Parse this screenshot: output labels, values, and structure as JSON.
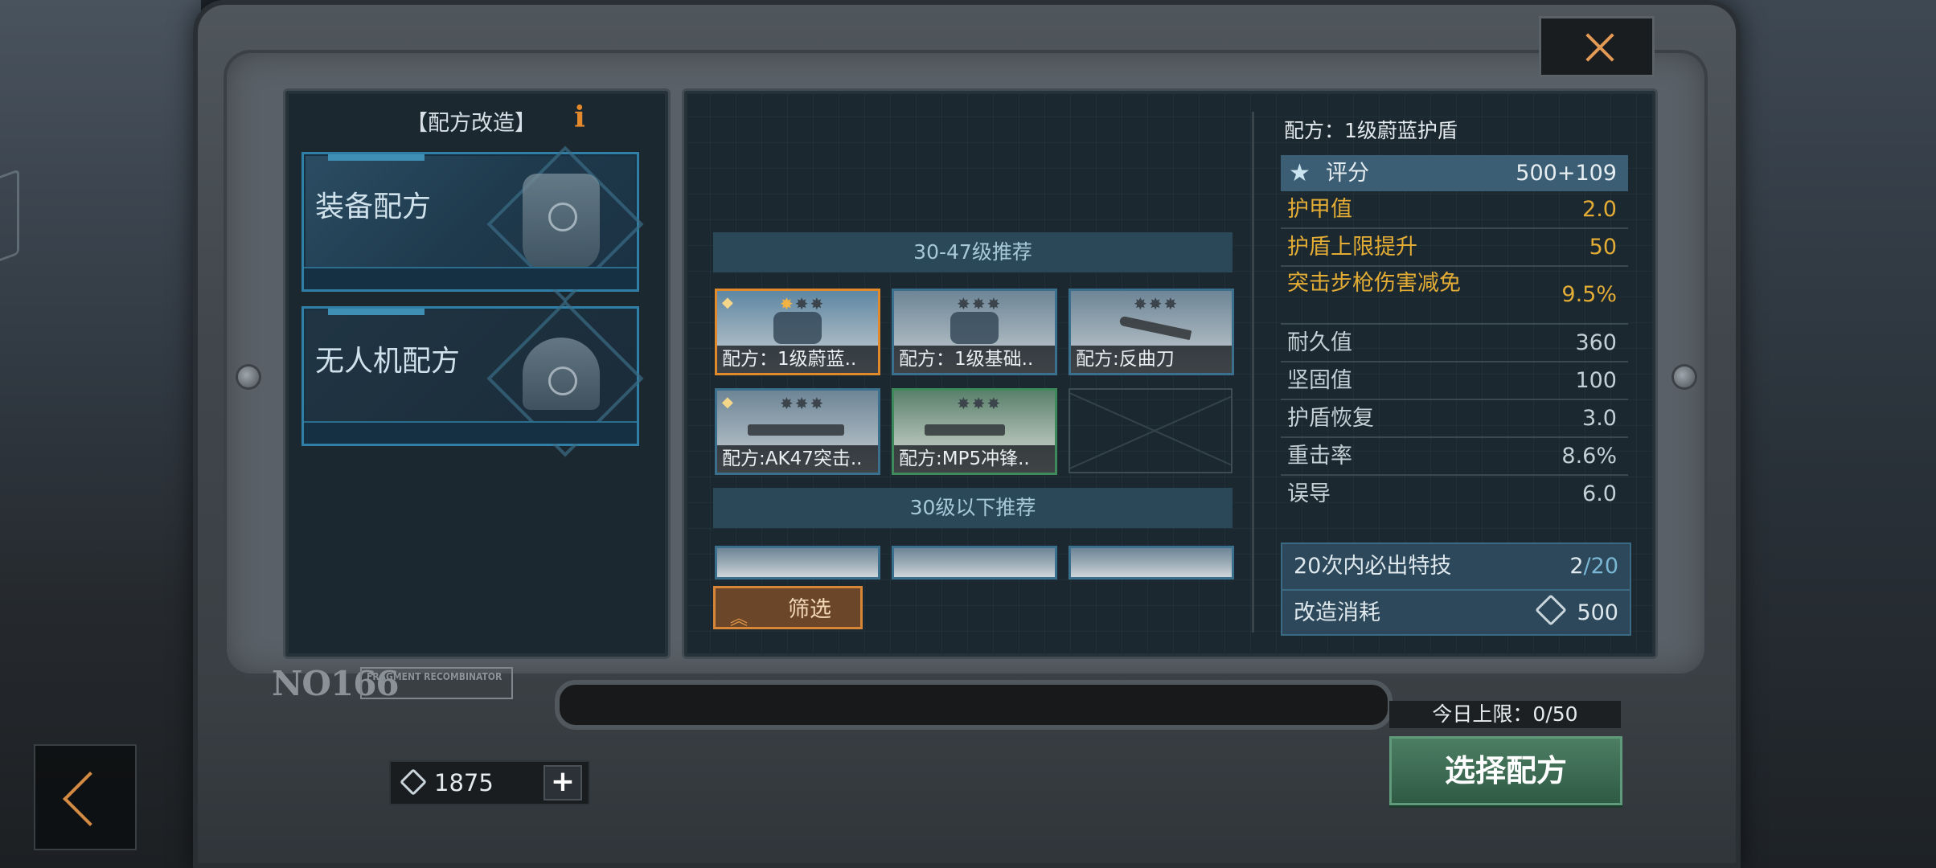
{
  "left": {
    "title": "【配方改造】",
    "info_glyph": "i",
    "cards": [
      {
        "label": "装备配方"
      },
      {
        "label": "无人机配方"
      }
    ]
  },
  "center": {
    "section1": "30-47级推荐",
    "section2": "30级以下推荐",
    "items": [
      {
        "caption": "配方：1级蔚蓝..",
        "border": "orange",
        "stars": 1
      },
      {
        "caption": "配方：1级基础..",
        "border": "blue",
        "stars": 0
      },
      {
        "caption": "配方:反曲刀",
        "border": "blue",
        "stars": 0
      },
      {
        "caption": "配方:AK47突击..",
        "border": "blue",
        "stars": 0
      },
      {
        "caption": "配方:MP5冲锋..",
        "border": "green",
        "stars": 0
      }
    ],
    "filter_label": "筛选"
  },
  "stats": {
    "title": "配方：1级蔚蓝护盾",
    "score": {
      "name": "评分",
      "value": "500+109"
    },
    "rows": [
      {
        "name": "护甲值",
        "value": "2.0",
        "style": "gold"
      },
      {
        "name": "护盾上限提升",
        "value": "50",
        "style": "gold"
      },
      {
        "name": "突击步枪伤害减免",
        "value": "9.5%",
        "style": "gold"
      },
      {
        "name": "耐久值",
        "value": "360",
        "style": "plain"
      },
      {
        "name": "坚固值",
        "value": "100",
        "style": "plain"
      },
      {
        "name": "护盾恢复",
        "value": "3.0",
        "style": "plain"
      },
      {
        "name": "重击率",
        "value": "8.6%",
        "style": "plain"
      },
      {
        "name": "误导",
        "value": "6.0",
        "style": "plain"
      }
    ],
    "special": {
      "name": "20次内必出特技",
      "current": "2",
      "total": "/20"
    },
    "cost": {
      "name": "改造消耗",
      "value": "500"
    }
  },
  "bottom": {
    "nameplate": "NO166",
    "tag": "FRAGMENT RECOMBINATOR",
    "daily_limit": "今日上限：0/50",
    "select_button": "选择配方",
    "currency": "1875",
    "plus": "+"
  },
  "colors": {
    "accent_orange": "#e08a2c",
    "gold_text": "#e2ac35",
    "select_green": "#3d6b52"
  }
}
